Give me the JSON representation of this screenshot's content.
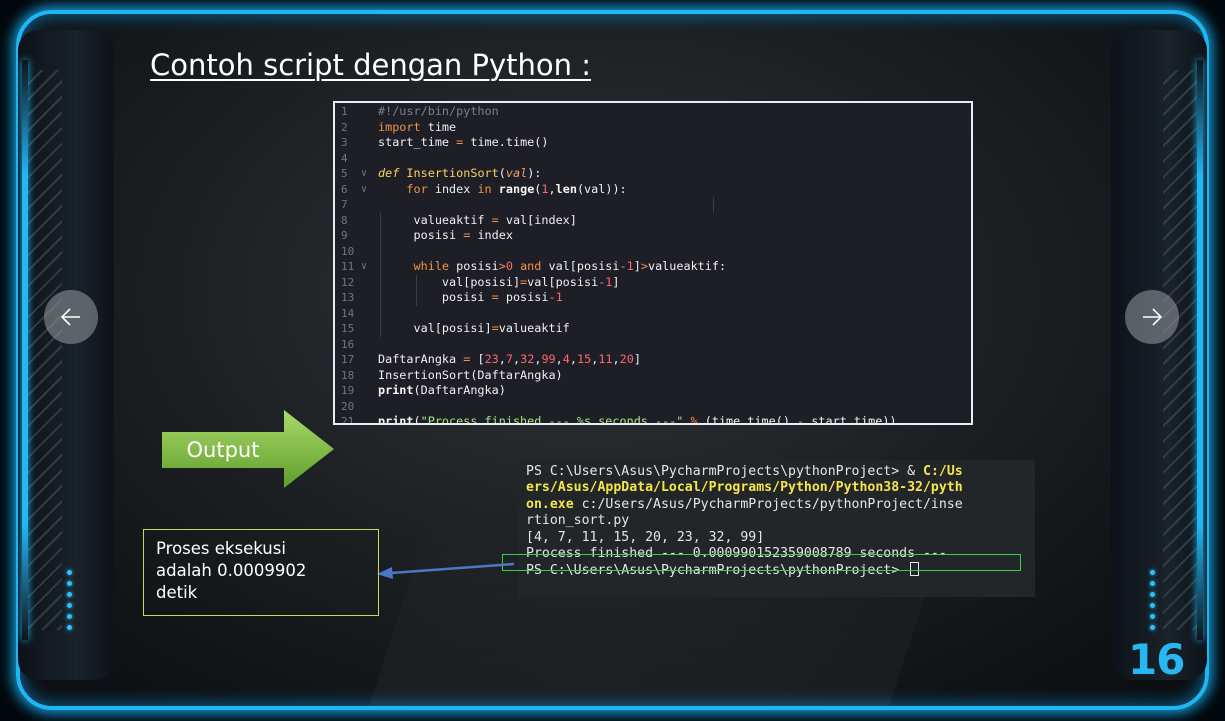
{
  "slide": {
    "title": "Contoh script dengan Python :",
    "page_number": "16",
    "output_label": "Output",
    "note_lines": [
      "Proses eksekusi",
      "adalah 0.0009902",
      "detik"
    ],
    "nav": {
      "prev_icon": "arrow-left-icon",
      "next_icon": "arrow-right-icon"
    }
  },
  "code": {
    "line_numbers": [
      "1",
      "2",
      "3",
      "4",
      "5",
      "6",
      "7",
      "8",
      "9",
      "10",
      "11",
      "12",
      "13",
      "14",
      "15",
      "16",
      "17",
      "18",
      "19",
      "20",
      "21"
    ]
  },
  "terminal": {
    "lines": [
      "PS C:\\Users\\Asus\\PycharmProjects\\pythonProject> & C:/Us",
      "ers/Asus/AppData/Local/Programs/Python/Python38-32/pyth",
      "on.exe c:/Users/Asus/PycharmProjects/pythonProject/inse",
      "rtion_sort.py",
      "[4, 7, 11, 15, 20, 23, 32, 99]",
      "Process finished --- 0.000990152359008789 seconds ---",
      "PS C:\\Users\\Asus\\PycharmProjects\\pythonProject> "
    ]
  },
  "colors": {
    "frame_glow": "#1fb6f2",
    "arrow_green": "#7bc142",
    "highlight_green": "#35d04e",
    "page_number": "#27b8f4",
    "connector_blue": "#4a78c8"
  }
}
